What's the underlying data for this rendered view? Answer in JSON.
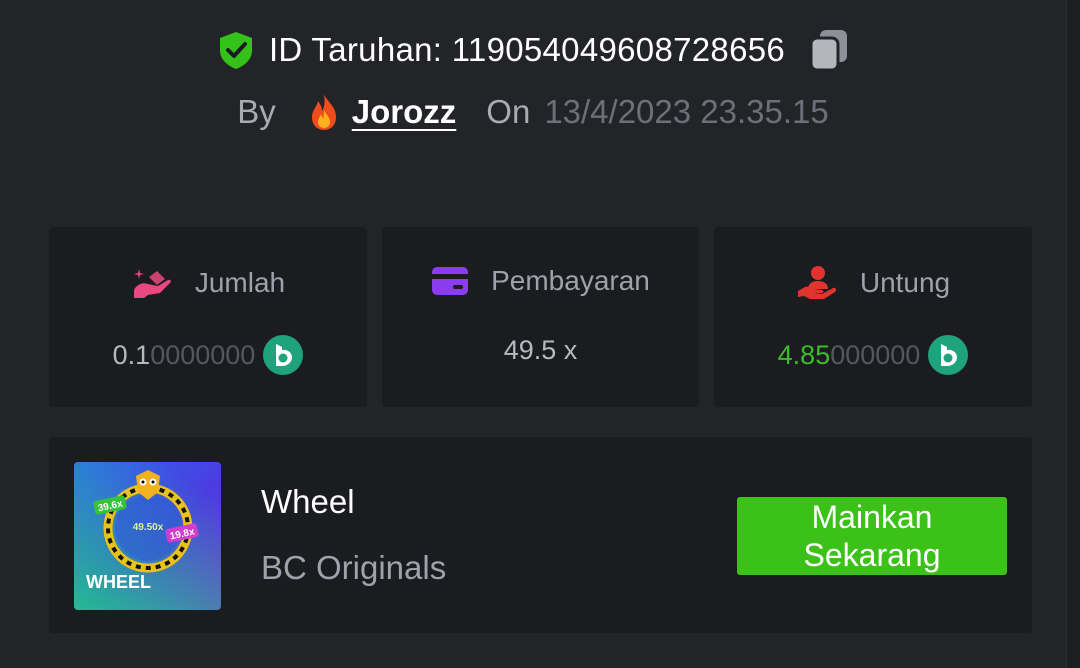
{
  "header": {
    "bet_id_label": "ID Taruhan: 119054049608728656",
    "by_label": "By",
    "username": "Jorozz",
    "on_label": "On",
    "timestamp": "13/4/2023 23.35.15"
  },
  "stats": {
    "amount": {
      "label": "Jumlah",
      "value_main": "0.1",
      "value_faded": "0000000",
      "currency_icon": "bc-coin-icon"
    },
    "payout": {
      "label": "Pembayaran",
      "value": "49.5 x"
    },
    "profit": {
      "label": "Untung",
      "value_main": "4.85",
      "value_faded": "000000",
      "currency_icon": "bc-coin-icon"
    }
  },
  "game": {
    "title": "Wheel",
    "provider": "BC Originals",
    "play_label_line1": "Mainkan",
    "play_label_line2": "Sekarang",
    "thumbnail": {
      "title": "WHEEL",
      "badge1": "39.6x",
      "badge2": "49.50x",
      "badge3": "19.8x"
    }
  },
  "colors": {
    "background": "#232427",
    "card": "#1b1c1f",
    "accent_green": "#3bc117",
    "shield_green": "#34c21a",
    "jumlah_icon": "#e8487d",
    "payout_icon": "#8b3cf0",
    "profit_icon": "#e0342e",
    "coin": "#1fa37c"
  }
}
